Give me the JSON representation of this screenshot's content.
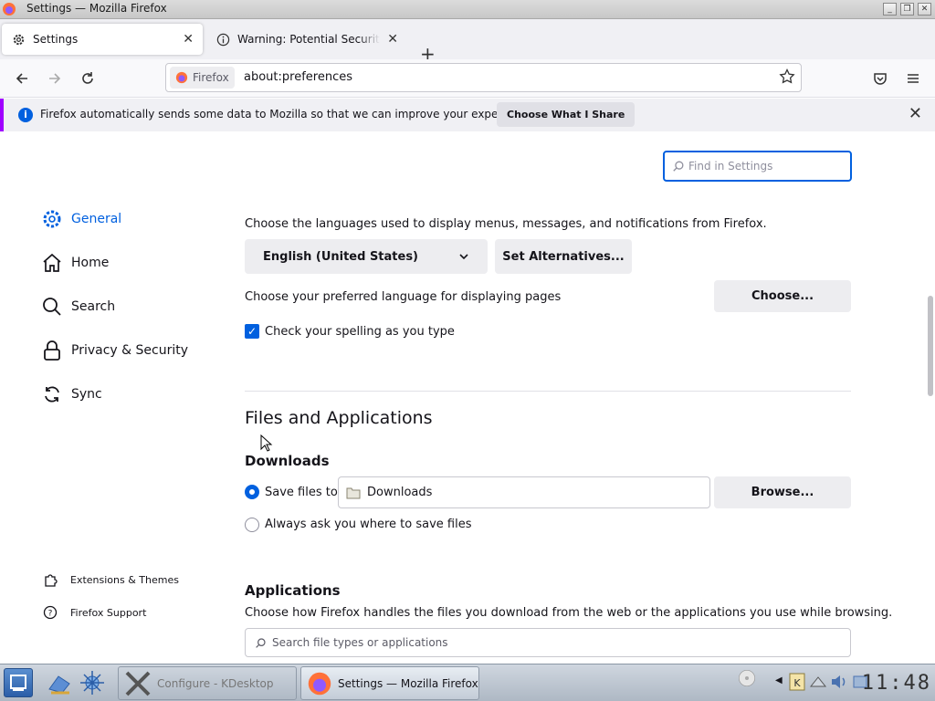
{
  "window": {
    "title": "Settings — Mozilla Firefox"
  },
  "tabs": [
    {
      "label": "Settings",
      "icon": "gear-icon",
      "active": true
    },
    {
      "label": "Warning: Potential Security Risk",
      "icon": "info-icon",
      "active": false
    }
  ],
  "newtab_label": "+",
  "urlbar": {
    "identity": "Firefox",
    "url": "about:preferences"
  },
  "notification": {
    "message": "Firefox automatically sends some data to Mozilla so that we can improve your experience.",
    "button": "Choose What I Share"
  },
  "search": {
    "placeholder": "Find in Settings"
  },
  "sidebar": {
    "items": [
      {
        "label": "General",
        "icon": "gear-icon",
        "selected": true
      },
      {
        "label": "Home",
        "icon": "home-icon"
      },
      {
        "label": "Search",
        "icon": "search-icon"
      },
      {
        "label": "Privacy & Security",
        "icon": "lock-icon"
      },
      {
        "label": "Sync",
        "icon": "sync-icon"
      }
    ],
    "footer": [
      {
        "label": "Extensions & Themes",
        "icon": "puzzle-icon"
      },
      {
        "label": "Firefox Support",
        "icon": "help-icon"
      }
    ]
  },
  "language": {
    "description": "Choose the languages used to display menus, messages, and notifications from Firefox.",
    "selected": "English (United States)",
    "alternatives_button": "Set Alternatives...",
    "pages_label": "Choose your preferred language for displaying pages",
    "choose_button": "Choose...",
    "spell_check_label": "Check your spelling as you type",
    "spell_check": true
  },
  "files": {
    "heading": "Files and Applications",
    "downloads_heading": "Downloads",
    "save_files_label": "Save files to",
    "folder": "Downloads",
    "browse_button": "Browse...",
    "always_ask_label": "Always ask you where to save files",
    "save_files_selected": true
  },
  "applications": {
    "heading": "Applications",
    "description": "Choose how Firefox handles the files you download from the web or the applications you use while browsing.",
    "search_placeholder": "Search file types or applications"
  },
  "taskbar": {
    "tasks": [
      {
        "label": "Configure - KDesktop",
        "active": false
      },
      {
        "label": "Settings — Mozilla Firefox",
        "active": true
      }
    ],
    "clock": "11:48"
  },
  "colors": {
    "accent": "#0060df",
    "notification_border": "#a000ff"
  }
}
